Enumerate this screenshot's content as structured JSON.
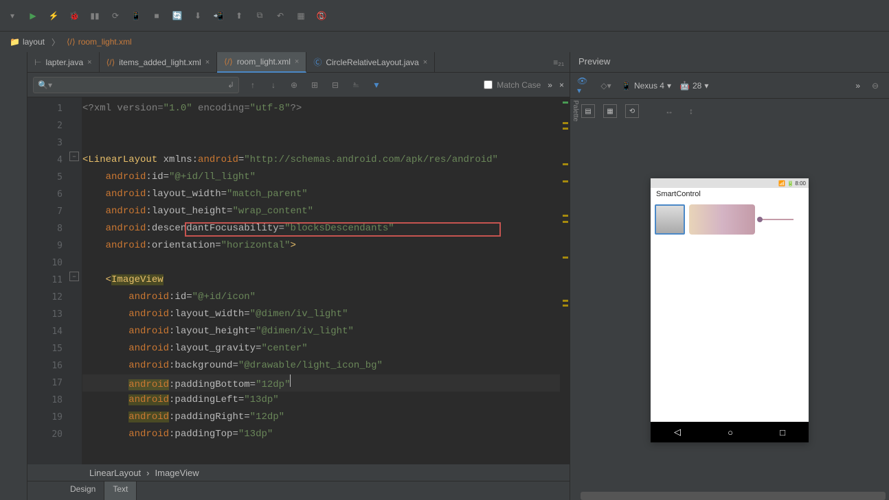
{
  "toolbar": {},
  "breadcrumb": {
    "folder": "layout",
    "file": "room_light.xml"
  },
  "tabs": [
    {
      "label": "lapter.java",
      "active": false
    },
    {
      "label": "items_added_light.xml",
      "active": false
    },
    {
      "label": "room_light.xml",
      "active": true
    },
    {
      "label": "CircleRelativeLayout.java",
      "active": false
    }
  ],
  "find": {
    "match_case": "Match Case"
  },
  "gutter_lines": [
    "1",
    "2",
    "3",
    "4",
    "5",
    "6",
    "7",
    "8",
    "9",
    "10",
    "11",
    "12",
    "13",
    "14",
    "15",
    "16",
    "17",
    "18",
    "19",
    "20"
  ],
  "code": {
    "l1_a": "<?",
    "l1_b": "xml version=",
    "l1_c": "\"1.0\"",
    "l1_d": " encoding=",
    "l1_e": "\"utf-8\"",
    "l1_f": "?>",
    "l4_a": "<",
    "l4_b": "LinearLayout",
    "l4_c": " xmlns:",
    "l4_d": "android",
    "l4_e": "=",
    "l4_f": "\"http://schemas.android.com/apk/res/android\"",
    "l5_a": "    ",
    "l5_ns": "android",
    "l5_attr": ":id=",
    "l5_val": "\"@+id/ll_light\"",
    "l6_attr": ":layout_width=",
    "l6_val": "\"match_parent\"",
    "l7_attr": ":layout_height=",
    "l7_val": "\"wrap_content\"",
    "l8_attr": ":descendantFocusability=",
    "l8_val": "\"blocksDescendants\"",
    "l9_attr": ":orientation=",
    "l9_val": "\"horizontal\"",
    "l9_end": ">",
    "l11_a": "    <",
    "l11_b": "ImageView",
    "l12_attr": ":id=",
    "l12_val": "\"@+id/icon\"",
    "l13_attr": ":layout_width=",
    "l13_val": "\"@dimen/iv_light\"",
    "l14_attr": ":layout_height=",
    "l14_val": "\"@dimen/iv_light\"",
    "l15_attr": ":layout_gravity=",
    "l15_val": "\"center\"",
    "l16_attr": ":background=",
    "l16_val": "\"@drawable/light_icon_bg\"",
    "l17_attr": ":paddingBottom=",
    "l17_val": "\"12dp\"",
    "l18_attr": ":paddingLeft=",
    "l18_val": "\"13dp\"",
    "l19_attr": ":paddingRight=",
    "l19_val": "\"12dp\"",
    "l20_attr": ":paddingTop=",
    "l20_val": "\"13dp\""
  },
  "status": {
    "p1": "LinearLayout",
    "sep": "›",
    "p2": "ImageView"
  },
  "bottom_tabs": {
    "design": "Design",
    "text": "Text"
  },
  "preview": {
    "title": "Preview",
    "device": "Nexus 4",
    "api": "28",
    "app_title": "SmartControl",
    "clock": "8:00",
    "palette": "Palette"
  }
}
